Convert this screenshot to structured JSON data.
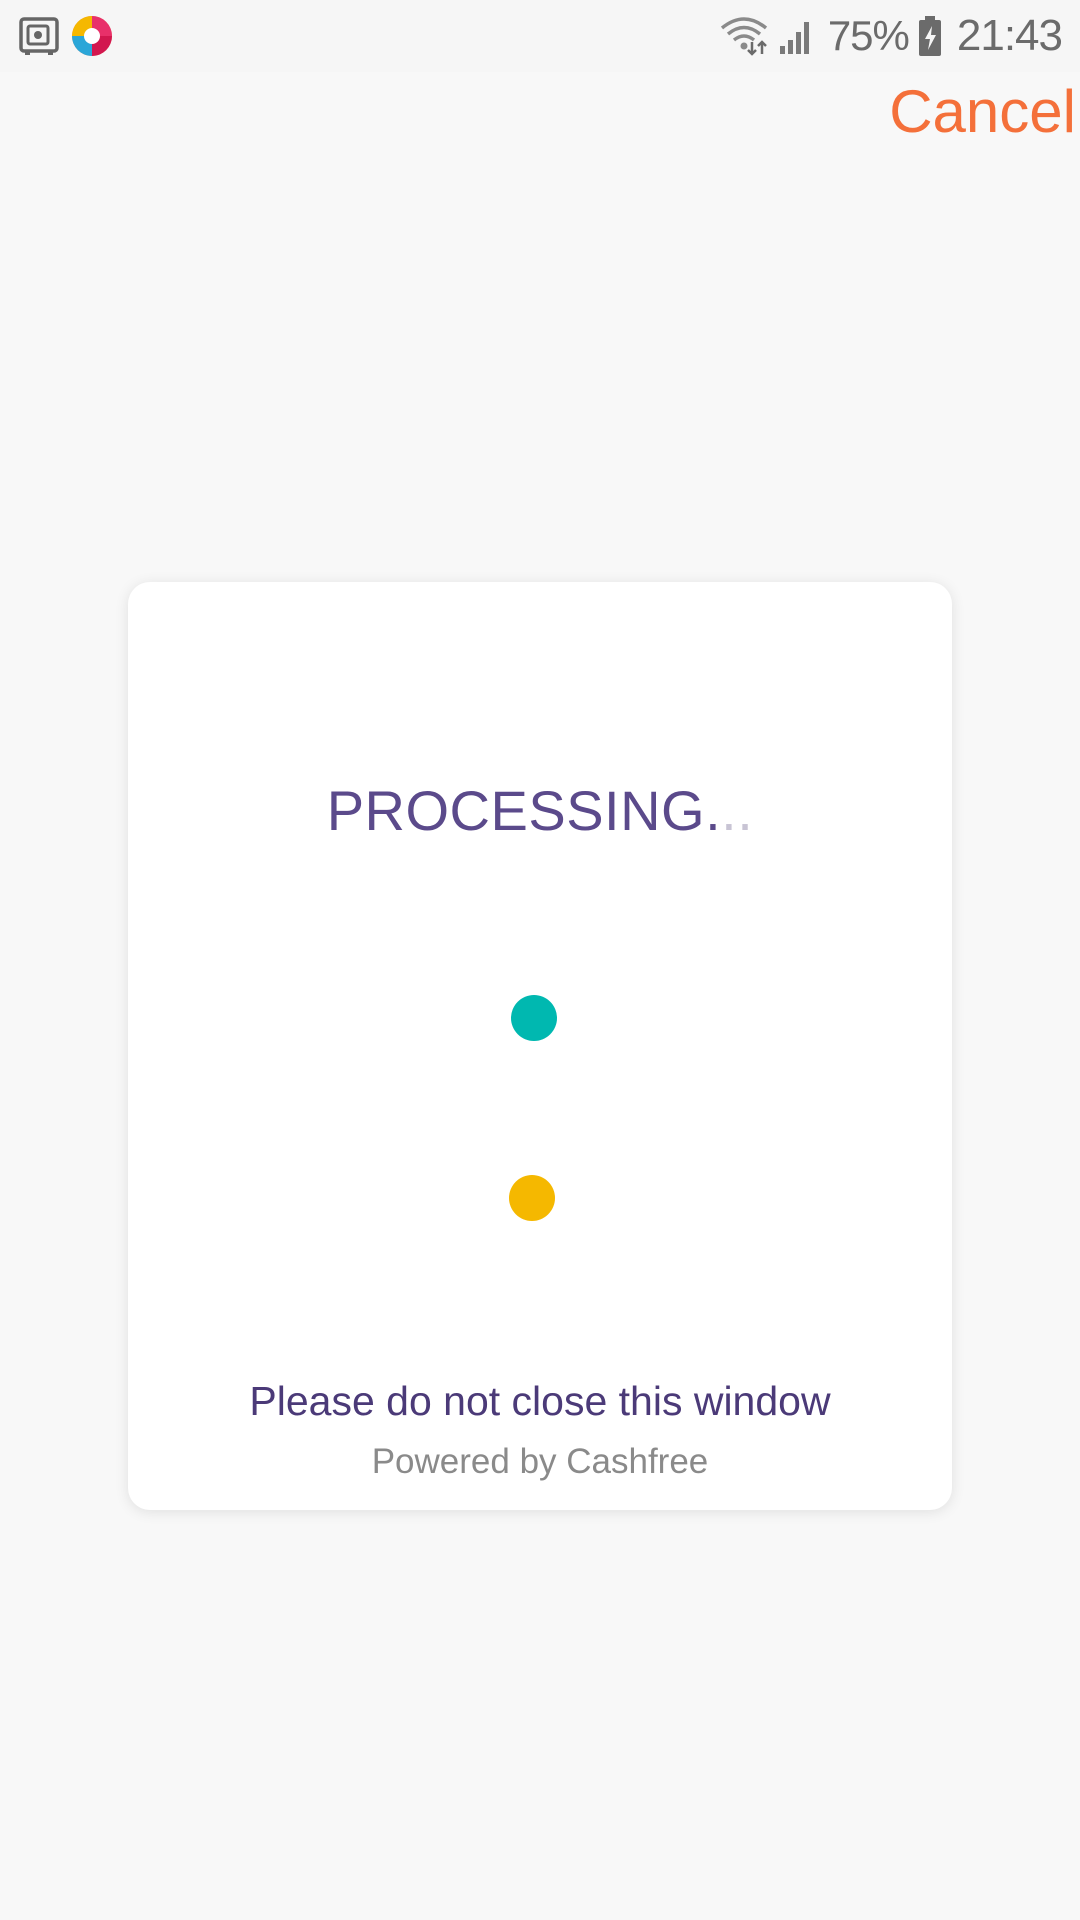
{
  "status_bar": {
    "left_icons": [
      "safe-icon",
      "app-logo-icon"
    ],
    "right_icons": [
      "wifi-icon",
      "signal-icon",
      "battery-icon"
    ],
    "battery_percent": "75%",
    "time": "21:43"
  },
  "top_bar": {
    "cancel_label": "Cancel",
    "accent_color": "#f4703a"
  },
  "card": {
    "title": "PROCESSING",
    "title_dots_solid": ".",
    "title_dots_faded": "..",
    "loader_colors": {
      "teal": "#00b8b0",
      "yellow": "#f5b800"
    },
    "warning": "Please do not close this window",
    "powered_by": "Powered by Cashfree"
  }
}
